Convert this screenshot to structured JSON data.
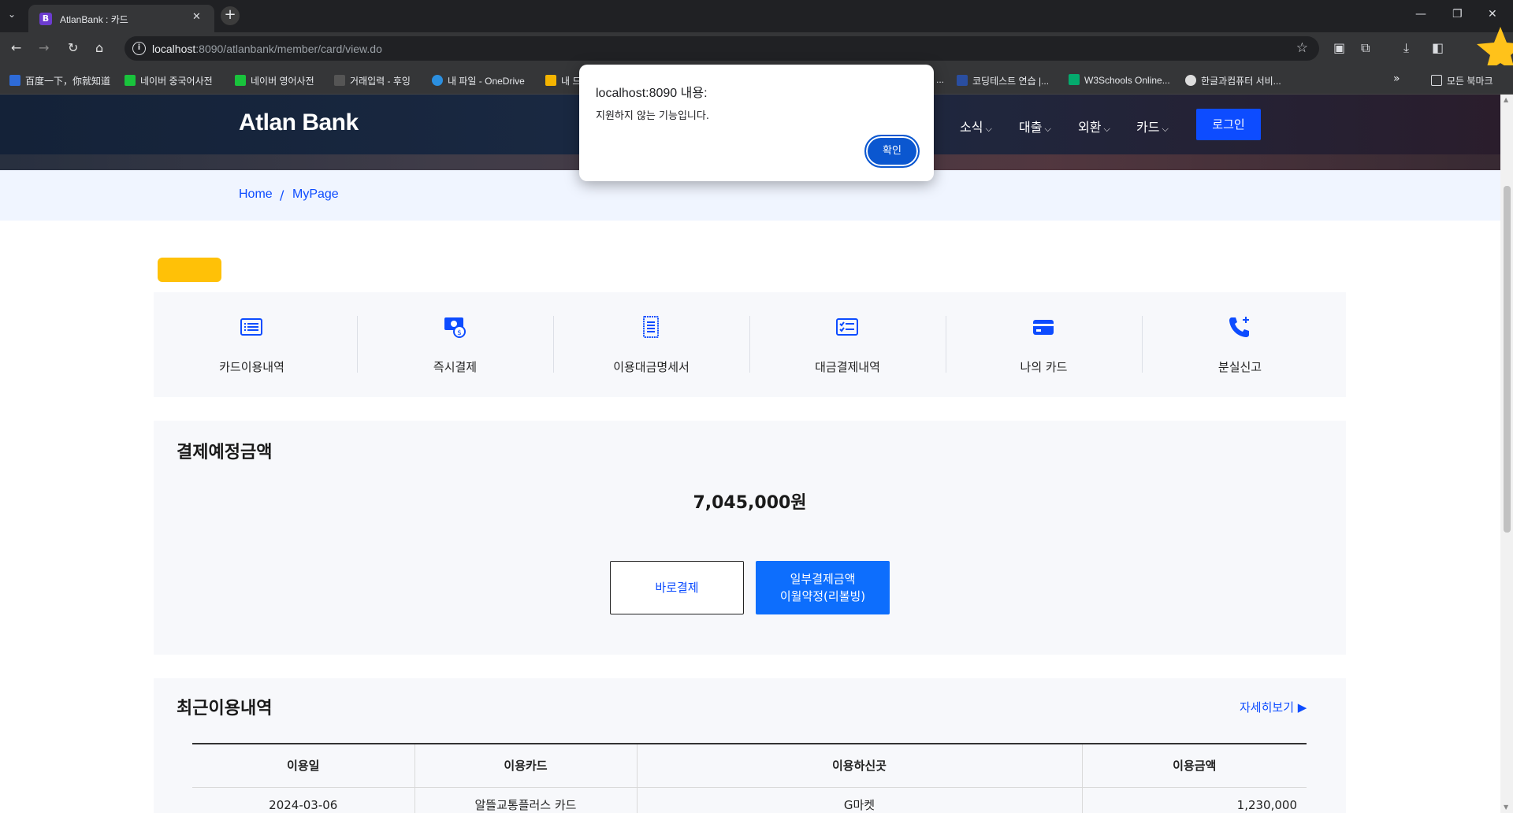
{
  "browser": {
    "tab_title": "AtlanBank : 카드",
    "tab_favicon": "B",
    "url_host": "localhost",
    "url_rest": ":8090/atlanbank/member/card/view.do",
    "bookmarks": [
      "百度一下，你就知道",
      "네이버 중국어사전",
      "네이버 영어사전",
      "거래입력 - 후잉",
      "내 파일 - OneDrive",
      "내 드",
      "...",
      "코딩테스트 연습 |...",
      "W3Schools Online...",
      "한글과컴퓨터 서비..."
    ],
    "all_bookmarks": "모든 북마크"
  },
  "site": {
    "brand": "Atlan Bank",
    "nav": [
      "소식",
      "대출",
      "외환",
      "카드"
    ],
    "login_label": "로그인",
    "breadcrumb": [
      "Home",
      "MyPage"
    ],
    "breadcrumb_sep": "/"
  },
  "quick_menu": [
    {
      "label": "카드이용내역",
      "icon": "list-icon"
    },
    {
      "label": "즉시결제",
      "icon": "instant-payment-icon"
    },
    {
      "label": "이용대금명세서",
      "icon": "statement-icon"
    },
    {
      "label": "대금결제내역",
      "icon": "payment-history-icon"
    },
    {
      "label": "나의 카드",
      "icon": "credit-card-icon"
    },
    {
      "label": "분실신고",
      "icon": "phone-plus-icon"
    }
  ],
  "payment": {
    "title": "결제예정금액",
    "amount": "7,045,000원",
    "pay_now_label": "바로결제",
    "revolving_line1": "일부결제금액",
    "revolving_line2": "이월약정(리볼빙)"
  },
  "recent": {
    "title": "최근이용내역",
    "more_label": "자세히보기",
    "columns": [
      "이용일",
      "이용카드",
      "이용하신곳",
      "이용금액"
    ],
    "rows": [
      [
        "2024-03-06",
        "알뜰교통플러스 카드",
        "G마켓",
        "1,230,000"
      ]
    ]
  },
  "alert": {
    "title": "localhost:8090 내용:",
    "message": "지원하지 않는 기능입니다.",
    "ok_label": "확인"
  },
  "colors": {
    "accent": "#0d4cff",
    "header_bg": "#142238",
    "tag_yellow": "#ffc107",
    "card_bg": "#f7f8fb"
  }
}
